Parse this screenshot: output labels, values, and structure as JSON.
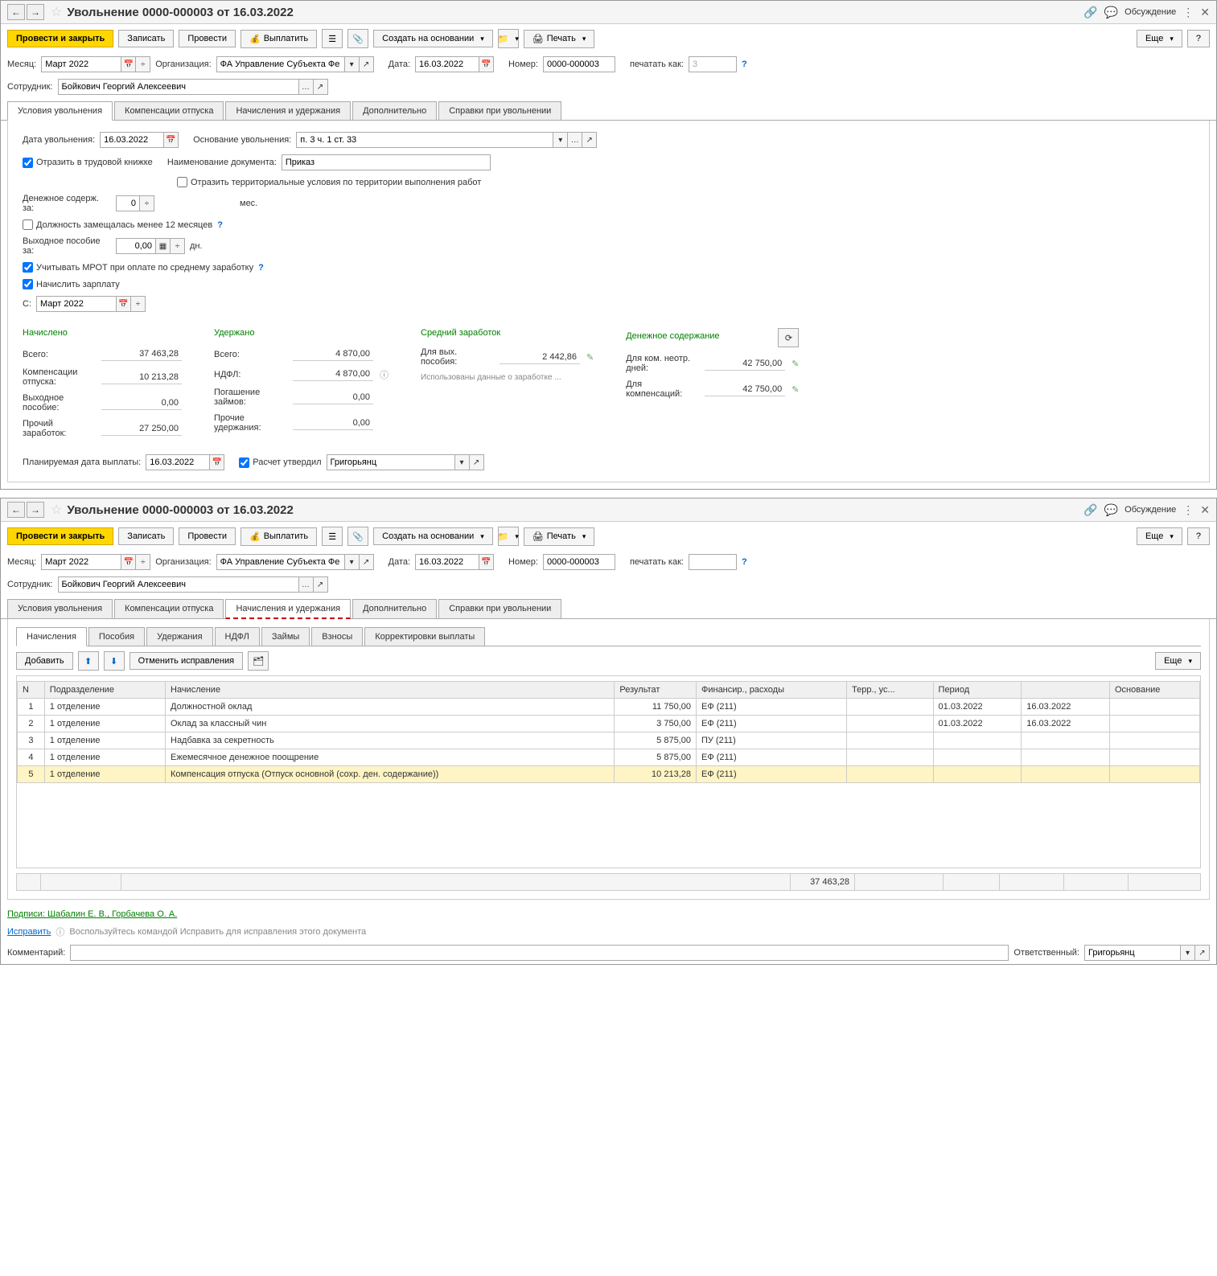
{
  "window1": {
    "title": "Увольнение 0000-000003 от 16.03.2022",
    "discussion": "Обсуждение",
    "toolbar": {
      "post_close": "Провести и закрыть",
      "save": "Записать",
      "post": "Провести",
      "pay": "Выплатить",
      "create_based": "Создать на основании",
      "print": "Печать",
      "more": "Еще",
      "help": "?"
    },
    "header": {
      "month_label": "Месяц:",
      "month": "Март 2022",
      "org_label": "Организация:",
      "org": "ФА Управление Субъекта Фе",
      "date_label": "Дата:",
      "date": "16.03.2022",
      "number_label": "Номер:",
      "number": "0000-000003",
      "print_as_label": "печатать как:",
      "print_as": "3",
      "employee_label": "Сотрудник:",
      "employee": "Бойкович Георгий Алексеевич"
    },
    "tabs": [
      "Условия увольнения",
      "Компенсации отпуска",
      "Начисления и удержания",
      "Дополнительно",
      "Справки при увольнении"
    ],
    "conditions": {
      "dismiss_date_label": "Дата увольнения:",
      "dismiss_date": "16.03.2022",
      "basis_label": "Основание увольнения:",
      "basis": "п. 3 ч. 1 ст. 33",
      "reflect_label": "Отразить в трудовой книжке",
      "doc_name_label": "Наименование документа:",
      "doc_name": "Приказ",
      "reflect_terr": "Отразить территориальные условия по территории выполнения работ",
      "money_label": "Денежное содерж. за:",
      "money_val": "0",
      "money_unit": "мес.",
      "position_less12": "Должность замещалась менее 12 месяцев",
      "severance_label": "Выходное пособие за:",
      "severance_val": "0,00",
      "severance_unit": "дн.",
      "mrot_label": "Учитывать МРОТ при оплате по среднему заработку",
      "accrue_salary": "Начислить зарплату",
      "from_label": "С:",
      "from_val": "Март 2022"
    },
    "totals": {
      "accrued_header": "Начислено",
      "withheld_header": "Удержано",
      "avg_header": "Средний заработок",
      "money_header": "Денежное содержание",
      "total_label": "Всего:",
      "accrued_total": "37 463,28",
      "comp_label": "Компенсации отпуска:",
      "comp_val": "10 213,28",
      "sev_label": "Выходное пособие:",
      "sev_val": "0,00",
      "other_label": "Прочий заработок:",
      "other_val": "27 250,00",
      "withheld_total": "4 870,00",
      "ndfl_label": "НДФЛ:",
      "ndfl_val": "4 870,00",
      "loan_label": "Погашение займов:",
      "loan_val": "0,00",
      "other_w_label": "Прочие удержания:",
      "other_w_val": "0,00",
      "sev_benefit_label": "Для вых. пособия:",
      "sev_benefit_val": "2 442,86",
      "data_hint": "Использованы данные о заработке ...",
      "unused_label": "Для ком. неотр. дней:",
      "unused_val": "42 750,00",
      "comp2_label": "Для компенсаций:",
      "comp2_val": "42 750,00"
    },
    "footer": {
      "planned_label": "Планируемая дата выплаты:",
      "planned_date": "16.03.2022",
      "approved_label": "Расчет утвердил",
      "approver": "Григорьянц"
    }
  },
  "window2": {
    "title": "Увольнение 0000-000003 от 16.03.2022",
    "discussion": "Обсуждение",
    "toolbar": {
      "post_close": "Провести и закрыть",
      "save": "Записать",
      "post": "Провести",
      "pay": "Выплатить",
      "create_based": "Создать на основании",
      "print": "Печать",
      "more": "Еще",
      "help": "?"
    },
    "header": {
      "month_label": "Месяц:",
      "month": "Март 2022",
      "org_label": "Организация:",
      "org": "ФА Управление Субъекта Фе",
      "date_label": "Дата:",
      "date": "16.03.2022",
      "number_label": "Номер:",
      "number": "0000-000003",
      "print_as_label": "печатать как:",
      "employee_label": "Сотрудник:",
      "employee": "Бойкович Георгий Алексеевич"
    },
    "tabs": [
      "Условия увольнения",
      "Компенсации отпуска",
      "Начисления и удержания",
      "Дополнительно",
      "Справки при увольнении"
    ],
    "subtabs": [
      "Начисления",
      "Пособия",
      "Удержания",
      "НДФЛ",
      "Займы",
      "Взносы",
      "Корректировки выплаты"
    ],
    "tb2": {
      "add": "Добавить",
      "cancel": "Отменить исправления",
      "more": "Еще"
    },
    "table": {
      "cols": [
        "N",
        "Подразделение",
        "Начисление",
        "Результат",
        "Финансир., расходы",
        "Терр., ус...",
        "Период",
        "",
        "Основание"
      ],
      "rows": [
        {
          "n": "1",
          "dep": "1 отделение",
          "acc": "Должностной оклад",
          "res": "11 750,00",
          "fin": "ЕФ (211)",
          "terr": "",
          "p1": "01.03.2022",
          "p2": "16.03.2022",
          "basis": ""
        },
        {
          "n": "2",
          "dep": "1 отделение",
          "acc": "Оклад за классный чин",
          "res": "3 750,00",
          "fin": "ЕФ (211)",
          "terr": "",
          "p1": "01.03.2022",
          "p2": "16.03.2022",
          "basis": ""
        },
        {
          "n": "3",
          "dep": "1 отделение",
          "acc": "Надбавка за секретность",
          "res": "5 875,00",
          "fin": "ПУ (211)",
          "terr": "",
          "p1": "",
          "p2": "",
          "basis": ""
        },
        {
          "n": "4",
          "dep": "1 отделение",
          "acc": "Ежемесячное денежное поощрение",
          "res": "5 875,00",
          "fin": "ЕФ (211)",
          "terr": "",
          "p1": "",
          "p2": "",
          "basis": ""
        },
        {
          "n": "5",
          "dep": "1 отделение",
          "acc": "Компенсация отпуска (Отпуск основной (сохр. ден. содержание))",
          "res": "10 213,28",
          "fin": "ЕФ (211)",
          "terr": "",
          "p1": "",
          "p2": "",
          "basis": ""
        }
      ],
      "total": "37 463,28"
    },
    "footer": {
      "signs": "Подписи: Шабалин Е. В., Горбачева О. А.",
      "correct": "Исправить",
      "correct_hint": "Воспользуйтесь командой Исправить для исправления этого документа",
      "comment_label": "Комментарий:",
      "responsible_label": "Ответственный:",
      "responsible": "Григорьянц"
    }
  }
}
